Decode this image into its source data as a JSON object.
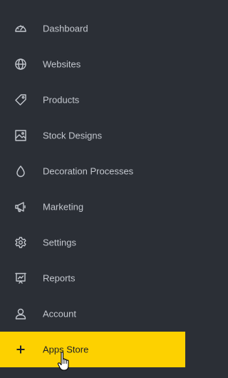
{
  "sidebar": {
    "items": [
      {
        "label": "Dashboard",
        "icon": "dashboard-gauge-icon"
      },
      {
        "label": "Websites",
        "icon": "globe-icon"
      },
      {
        "label": "Products",
        "icon": "tag-icon"
      },
      {
        "label": "Stock Designs",
        "icon": "image-icon"
      },
      {
        "label": "Decoration Processes",
        "icon": "droplet-icon"
      },
      {
        "label": "Marketing",
        "icon": "megaphone-icon"
      },
      {
        "label": "Settings",
        "icon": "gear-icon"
      },
      {
        "label": "Reports",
        "icon": "report-chart-icon"
      },
      {
        "label": "Account",
        "icon": "user-icon"
      },
      {
        "label": "Apps Store",
        "icon": "plus-icon",
        "active": true
      }
    ]
  },
  "colors": {
    "background": "#2b2f36",
    "text": "#c3c7ce",
    "active_background": "#fdd100",
    "active_text": "#1e2127"
  }
}
